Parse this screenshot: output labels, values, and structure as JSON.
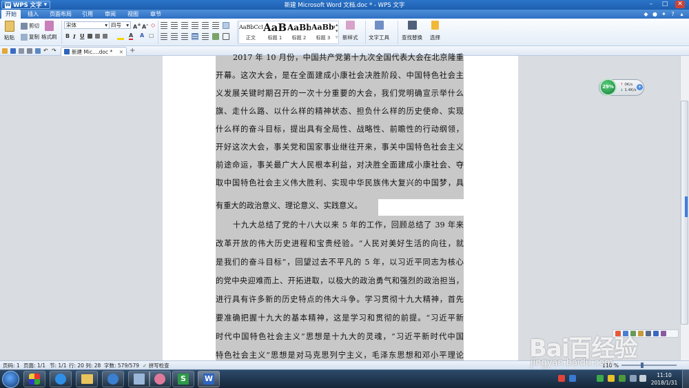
{
  "titlebar": {
    "app_name": "WPS 文字",
    "doc_title": "新建 Microsoft Word 文档.doc * - WPS 文字",
    "minimize": "–",
    "maximize": "□",
    "close": "✕"
  },
  "menu": {
    "tabs": [
      "开始",
      "插入",
      "页面布局",
      "引用",
      "审阅",
      "视图",
      "章节"
    ],
    "active": "开始"
  },
  "ribbon": {
    "paste": "粘贴",
    "cut": "剪切",
    "copy": "复制",
    "format_painter": "格式刷",
    "font_name": "宋体",
    "font_size": "四号",
    "bold": "B",
    "italic": "I",
    "underline": "U",
    "styles": [
      {
        "sample": "AaBbCcDd",
        "label": "正文"
      },
      {
        "sample": "AaBl",
        "label": "标题 1"
      },
      {
        "sample": "AaBb(",
        "label": "标题 2"
      },
      {
        "sample": "AaBbC",
        "label": "标题 3"
      }
    ],
    "new_style": "新样式",
    "text_tools": "文字工具",
    "find_replace": "查找替换",
    "select": "选择"
  },
  "tabbar": {
    "doc_tab_label": "新建 Mic....doc *",
    "close": "✕",
    "add": "+"
  },
  "document": {
    "lines": [
      "2017 年 10 月份，中国共产党第十九次全国代表大会在北京隆重",
      "开幕。这次大会，是在全面建成小康社会决胜阶段、中国特色社会主",
      "义发展关键时期召开的一次十分重要的大会，我们党明确宣示举什么",
      "旗、走什么路、以什么样的精神状态、担负什么样的历史使命、实现",
      "什么样的奋斗目标，提出具有全局性、战略性、前瞻性的行动纲领，",
      "开好这次大会，事关党和国家事业继往开来，事关中国特色社会主义",
      "前途命运，事关最广大人民根本利益，对决胜全面建成小康社会、夺",
      "取中国特色社会主义伟大胜利、实现中华民族伟大复兴的中国梦，具",
      "有重大的政治意义、理论意义、实践意义。",
      "十九大总结了党的十八大以来 5 年的工作，回顾总结了 39 年来",
      "改革开放的伟大历史进程和宝贵经验。“人民对美好生活的向往，就",
      "是我们的奋斗目标”，回望过去不平凡的 5 年，以习近平同志为核心",
      "的党中央迎难而上、开拓进取，以极大的政治勇气和强烈的政治担当，",
      "进行具有许多新的历史特点的伟大斗争。学习贯彻十九大精神，首先",
      "要准确把握十九大的基本精神，这是学习和贯彻的前提。“习近平新",
      "时代中国特色社会主义”思想是十九大的灵魂，“习近平新时代中国",
      "特色社会主义”思想是对马克思列宁主义，毛泽东思想和邓小平理论"
    ]
  },
  "widget": {
    "percent": "29%",
    "up": "0K/s",
    "down": "1.4K/s"
  },
  "statusbar": {
    "page_no": "页码: 1",
    "pages": "页面: 1/1",
    "section": "节: 1/1",
    "row_col": "行: 20  列: 28",
    "word_count": "字数: 579/579",
    "spell_check": "拼写检查",
    "zoom": "110 %"
  },
  "taskbar": {
    "time": "11:10",
    "date": "2018/1/31"
  },
  "watermark": {
    "text": "Bai百经验",
    "url": "jingyan.baidu.com"
  },
  "colors": {
    "accent": "#2c74c9",
    "selection": "#c8c8c8",
    "workspace": "#d9dce1"
  }
}
